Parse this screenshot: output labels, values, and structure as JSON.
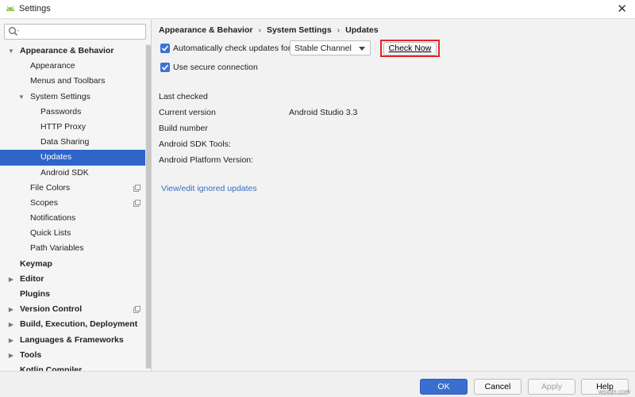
{
  "window": {
    "title": "Settings",
    "close_glyph": "✕"
  },
  "search": {
    "value": "",
    "placeholder": ""
  },
  "sidebar": {
    "items": [
      {
        "label": "Appearance & Behavior",
        "level": 0,
        "bold": true,
        "arrow": "▼"
      },
      {
        "label": "Appearance",
        "level": 1
      },
      {
        "label": "Menus and Toolbars",
        "level": 1
      },
      {
        "label": "System Settings",
        "level": 1,
        "arrow": "▼"
      },
      {
        "label": "Passwords",
        "level": 2
      },
      {
        "label": "HTTP Proxy",
        "level": 2
      },
      {
        "label": "Data Sharing",
        "level": 2
      },
      {
        "label": "Updates",
        "level": 2,
        "selected": true
      },
      {
        "label": "Android SDK",
        "level": 2
      },
      {
        "label": "File Colors",
        "level": 1,
        "project": true
      },
      {
        "label": "Scopes",
        "level": 1,
        "project": true
      },
      {
        "label": "Notifications",
        "level": 1
      },
      {
        "label": "Quick Lists",
        "level": 1
      },
      {
        "label": "Path Variables",
        "level": 1
      },
      {
        "label": "Keymap",
        "level": 0,
        "bold": true
      },
      {
        "label": "Editor",
        "level": 0,
        "bold": true,
        "arrow": "▶"
      },
      {
        "label": "Plugins",
        "level": 0,
        "bold": true
      },
      {
        "label": "Version Control",
        "level": 0,
        "bold": true,
        "arrow": "▶",
        "project": true
      },
      {
        "label": "Build, Execution, Deployment",
        "level": 0,
        "bold": true,
        "arrow": "▶"
      },
      {
        "label": "Languages & Frameworks",
        "level": 0,
        "bold": true,
        "arrow": "▶"
      },
      {
        "label": "Tools",
        "level": 0,
        "bold": true,
        "arrow": "▶"
      },
      {
        "label": "Kotlin Compiler",
        "level": 0,
        "bold": true
      }
    ]
  },
  "breadcrumb": {
    "part1": "Appearance & Behavior",
    "part2": "System Settings",
    "part3": "Updates",
    "separator": "›"
  },
  "updates": {
    "auto_check_label": "Automatically check updates for",
    "channel": "Stable Channel",
    "check_now_label": "Check Now",
    "secure_label": "Use secure connection"
  },
  "info": {
    "last_checked_label": "Last checked",
    "last_checked_value": "",
    "current_version_label": "Current version",
    "current_version_value": "Android Studio 3.3",
    "build_number_label": "Build number",
    "build_number_value": "",
    "sdk_tools_label": "Android SDK Tools:",
    "sdk_tools_value": "",
    "platform_version_label": "Android Platform Version:",
    "platform_version_value": ""
  },
  "ignored_link": "View/edit ignored updates",
  "footer": {
    "ok": "OK",
    "cancel": "Cancel",
    "apply": "Apply",
    "help": "Help"
  },
  "watermark": "wsxdn.com",
  "colors": {
    "accent": "#2f65ca",
    "highlight": "#e0242b",
    "android_green": "#8bc34a"
  }
}
